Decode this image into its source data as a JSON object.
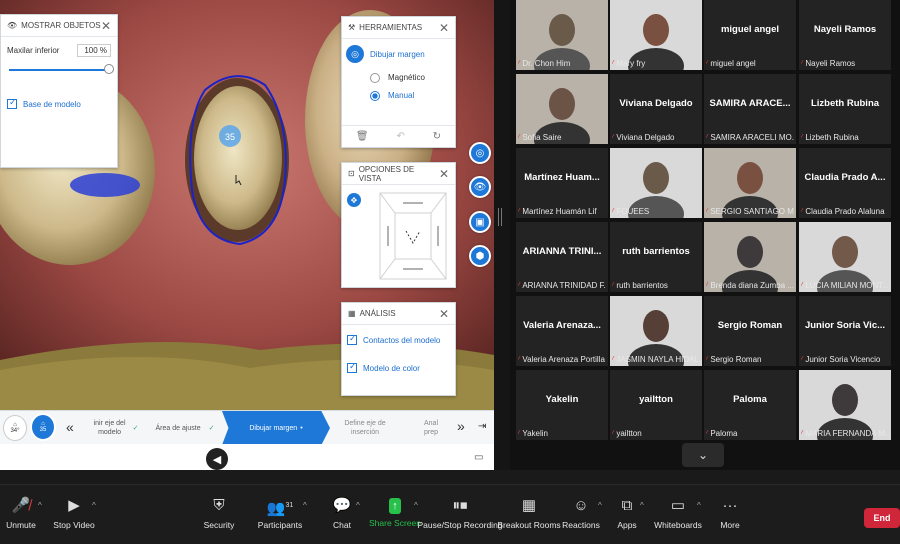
{
  "shared": {
    "objects_panel": {
      "title": "MOSTRAR OBJETOS",
      "row_label": "Maxilar inferior",
      "percent": "100 %",
      "opacity_level": 1.0,
      "checkbox_label": "Base de modelo"
    },
    "tools_panel": {
      "title": "HERRAMIENTAS",
      "main": "Dibujar margen",
      "opt1": "Magnético",
      "opt2": "Manual"
    },
    "view_panel": {
      "title": "OPCIONES DE VISTA"
    },
    "analysis_panel": {
      "title": "ANÁLISIS",
      "opt1": "Contactos del modelo",
      "opt2": "Modelo de color"
    },
    "tooth_number": "35",
    "steps": {
      "badge_top": "34°",
      "badge_bottom": "35",
      "s1": "inir eje del modelo",
      "s2": "Área de ajuste",
      "s3": "Dibujar margen",
      "s4": "Define eje de inserción",
      "s5": "Anal prep"
    }
  },
  "participants": [
    {
      "label": "Dr. Chon Him",
      "video": true
    },
    {
      "label": "Mary fry",
      "video": true
    },
    {
      "name": "miguel angel",
      "label": "miguel angel"
    },
    {
      "name": "Nayeli Ramos",
      "label": "Nayeli Ramos"
    },
    {
      "label": "Sofia Saire",
      "video": true
    },
    {
      "name": "Viviana Delgado",
      "label": "Viviana Delgado"
    },
    {
      "name": "SAMIRA ARACE...",
      "label": "SAMIRA ARACELI MO..."
    },
    {
      "name": "Lizbeth Rubina",
      "label": "Lizbeth Rubina"
    },
    {
      "name": "Martínez  Huam...",
      "label": "Martínez Huamán Lif"
    },
    {
      "label": "FOUEES",
      "video": true
    },
    {
      "label": "SERGIO SANTIAGO M...",
      "video": true
    },
    {
      "name": "Claudia  Prado  A...",
      "label": "Claudia Prado Alaluna"
    },
    {
      "name": "ARIANNA  TRINI...",
      "label": "ARIANNA TRINIDAD F..."
    },
    {
      "name": "ruth barrientos",
      "label": "ruth barrientos"
    },
    {
      "label": "Brenda diana Zumba ...",
      "video": true
    },
    {
      "label": "LUCIA MILIAN MONT...",
      "video": true
    },
    {
      "name": "Valeria  Arenaza...",
      "label": "Valeria Arenaza Portilla"
    },
    {
      "label": "JASMIN NAYLA HIDAL...",
      "video": true
    },
    {
      "name": "Sergio Roman",
      "label": "Sergio Roman"
    },
    {
      "name": "Junior  Soria  Vic...",
      "label": "Junior Soria Vicencio"
    },
    {
      "name": "Yakelin",
      "label": "Yakelin"
    },
    {
      "name": "yailtton",
      "label": "yailtton"
    },
    {
      "name": "Paloma",
      "label": "Paloma"
    },
    {
      "label": "MARIA FERNANDA M...",
      "video": true
    }
  ],
  "toolbar": {
    "unmute": "Unmute",
    "stop_video": "Stop Video",
    "security": "Security",
    "participants": "Participants",
    "participants_count": "31",
    "chat": "Chat",
    "share_screen": "Share Screen",
    "recording": "Pause/Stop Recording",
    "breakout": "Breakout Rooms",
    "reactions": "Reactions",
    "apps": "Apps",
    "whiteboards": "Whiteboards",
    "more": "More",
    "end": "End"
  },
  "colors": {
    "accent": "#1e78d7",
    "share_green": "#26c04a",
    "end_red": "#d0263a",
    "muted_red": "#e23b3b"
  }
}
